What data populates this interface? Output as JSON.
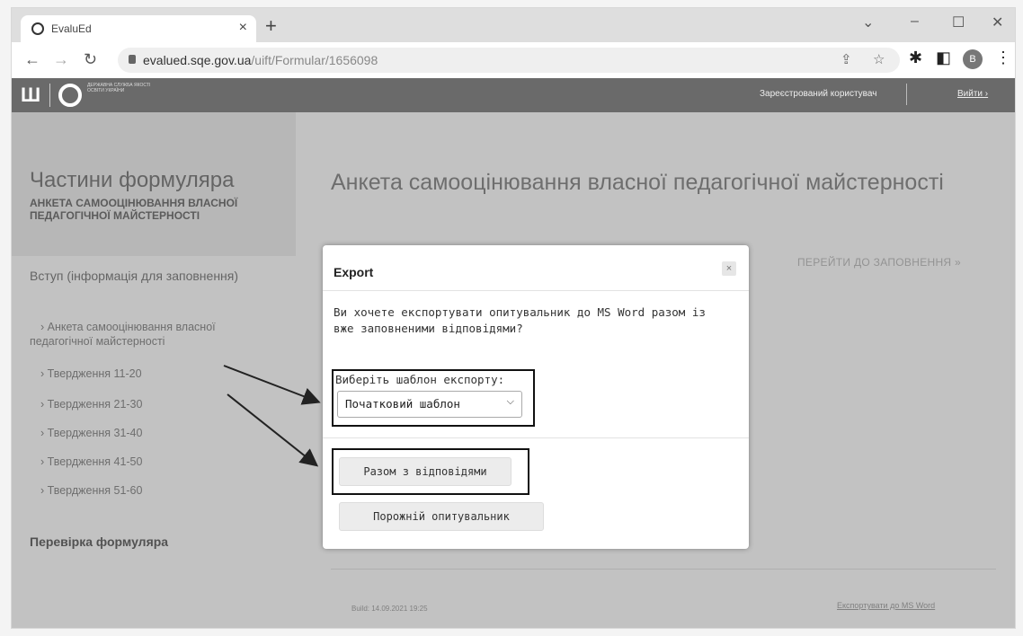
{
  "browser": {
    "tab_title": "EvaluEd",
    "tab_close": "×",
    "new_tab": "+",
    "url_host": "evalued.sqe.gov.ua",
    "url_path": "/uift/Formular/1656098",
    "profile_initial": "B"
  },
  "site_header": {
    "org_name": "ДЕРЖАВНА СЛУЖБА ЯКОСТІ ОСВІТИ УКРАЇНИ",
    "registered_user": "Зареєстрований користувач",
    "login": "Вийти ›"
  },
  "sidebar": {
    "title": "Частини формуляра",
    "subtitle": "АНКЕТА САМООЦІНЮВАННЯ ВЛАСНОЇ ПЕДАГОГІЧНОЇ МАЙСТЕРНОСТІ",
    "intro": "Вступ (інформація для заповнення)",
    "items": [
      {
        "label": "› Анкета самооцінювання власної"
      },
      {
        "label": "педагогічної майстерності"
      },
      {
        "label": "› Твердження 11-20"
      },
      {
        "label": "› Твердження 21-30"
      },
      {
        "label": "› Твердження 31-40"
      },
      {
        "label": "› Твердження 41-50"
      },
      {
        "label": "› Твердження 51-60"
      }
    ],
    "check": "Перевірка формуляра"
  },
  "main": {
    "title": "Анкета самооцінювання власної педагогічної майстерності",
    "goto_link": "ПЕРЕЙТИ ДО ЗАПОВНЕННЯ »",
    "build": "Build: 14.09.2021 19:25",
    "export_link": "Експортувати до MS Word"
  },
  "dialog": {
    "title": "Export",
    "close": "×",
    "message": "Ви хочете експортувати опитувальник до MS Word разом із вже заповненими відповідями?",
    "template_label": "Виберіть шаблон експорту:",
    "template_value": "Початковий шаблон",
    "btn_with_answers": "Разом з відповідями",
    "btn_empty": "Порожній опитувальник"
  }
}
